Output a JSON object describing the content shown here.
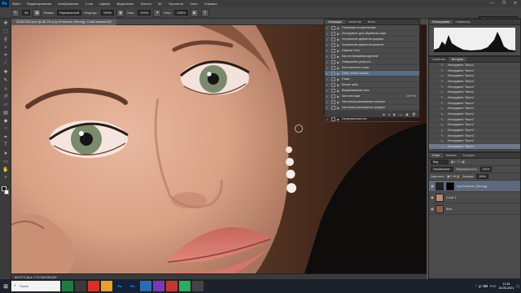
{
  "menubar": {
    "logo": "Ps",
    "items": [
      "Файл",
      "Редактирование",
      "Изображение",
      "Слои",
      "Шрифт",
      "Выделение",
      "Фильтр",
      "3D",
      "Просмотр",
      "Окно",
      "Справка"
    ],
    "window_controls": [
      "—",
      "❐",
      "✕"
    ]
  },
  "options": {
    "size": "45",
    "mode_label": "Режим:",
    "mode_value": "Нормальный",
    "opacity_label": "Непрозр.:",
    "opacity_value": "100%",
    "flow_label": "Наж.:",
    "flow_value": "100%",
    "flow2_label": "Наж.:",
    "flow2_value": "100%",
    "workspace": "Фотография"
  },
  "document": {
    "tab_title": "22367330.psd @ 66,7% (Lip Enhancer (Strong), Слой-маска/16)*",
    "status": "66,67%        Док: 172,9М/348,8М",
    "mini_tab": "Mini Bridge"
  },
  "actions": {
    "tabs": [
      "Операции",
      "Свойства",
      "Кисть"
    ],
    "active_tab": "Операции",
    "rows": [
      {
        "label": "Операции по умолчанию",
        "key": "",
        "selected": false,
        "checked": true
      },
      {
        "label": "Инструмент для обработки кожи",
        "key": "",
        "selected": false,
        "checked": true
      },
      {
        "label": "Устранение дефектов средних",
        "key": "",
        "selected": false,
        "checked": true
      },
      {
        "label": "Устранение дефектов сильное",
        "key": "",
        "selected": false,
        "checked": true
      },
      {
        "label": "Нижние тона",
        "key": "",
        "selected": false,
        "checked": true
      },
      {
        "label": "Как на глянцевом журнале",
        "key": "",
        "selected": false,
        "checked": true
      },
      {
        "label": "Повышение резкости",
        "key": "",
        "selected": false,
        "checked": true
      },
      {
        "label": "Контрастность кожи",
        "key": "",
        "selected": false,
        "checked": true
      },
      {
        "label": "Губы, очень сильно",
        "key": "",
        "selected": true,
        "checked": true
      },
      {
        "label": "Глаза",
        "key": "",
        "selected": false,
        "checked": true
      },
      {
        "label": "Белые зубы",
        "key": "",
        "selected": false,
        "checked": true
      },
      {
        "label": "Выравнивание тона",
        "key": "",
        "selected": false,
        "checked": true
      },
      {
        "label": "Чистота кожи",
        "key": "Ctrl+F4",
        "selected": false,
        "checked": true
      },
      {
        "label": "Частотное разложение сильное",
        "key": "",
        "selected": false,
        "checked": true
      },
      {
        "label": "Частотное разложение среднее",
        "key": "",
        "selected": false,
        "checked": true
      },
      {
        "label": "Частотное разложение",
        "key": "",
        "selected": false,
        "checked": true
      },
      {
        "label": "Остановочная поч",
        "key": "",
        "selected": false,
        "checked": true
      }
    ]
  },
  "histogram": {
    "tabs": [
      "Гистограмма",
      "Навигатор"
    ],
    "active_tab": "Гистограмма"
  },
  "history": {
    "tabs": [
      "Свойства",
      "История"
    ],
    "active_tab": "История",
    "rows": [
      {
        "label": "Инструмент \"Кисть\"",
        "selected": false
      },
      {
        "label": "Инструмент \"Кисть\"",
        "selected": false
      },
      {
        "label": "Инструмент \"Кисть\"",
        "selected": false
      },
      {
        "label": "Инструмент \"Кисть\"",
        "selected": false
      },
      {
        "label": "Инструмент \"Кисть\"",
        "selected": false
      },
      {
        "label": "Инструмент \"Кисть\"",
        "selected": false
      },
      {
        "label": "Инструмент \"Кисть\"",
        "selected": false
      },
      {
        "label": "Инструмент \"Кисть\"",
        "selected": false
      },
      {
        "label": "Инструмент \"Кисть\"",
        "selected": false
      },
      {
        "label": "Инструмент \"Кисть\"",
        "selected": false
      },
      {
        "label": "Инструмент \"Кисть\"",
        "selected": false
      },
      {
        "label": "Инструмент \"Кисть\"",
        "selected": false
      },
      {
        "label": "Инструмент \"Кисть\"",
        "selected": false
      },
      {
        "label": "Инструмент \"Кисть\"",
        "selected": false
      },
      {
        "label": "Инструмент \"Кисть\"",
        "selected": false
      },
      {
        "label": "Инструмент \"Кисть\"",
        "selected": true
      }
    ]
  },
  "layers": {
    "tabs": [
      "Слои",
      "Каналы",
      "Контуры"
    ],
    "active_tab": "Слои",
    "kind": "Вид",
    "blend": "Нормальные",
    "opacity_label": "Непрозрачность:",
    "opacity": "100%",
    "lock_label": "Закрепить:",
    "fill_label": "Заливка:",
    "fill": "100%",
    "rows": [
      {
        "label": "Lip Enhancer (Strong)",
        "selected": true,
        "thumb": "#222222"
      },
      {
        "label": "Слой 1",
        "selected": false,
        "thumb": "#b98a70"
      },
      {
        "label": "Фон",
        "selected": false,
        "thumb": "#8a5f4a"
      }
    ]
  },
  "taskbar": {
    "search_placeholder": "Поиск",
    "apps": [
      "",
      "",
      "",
      "",
      "Ps",
      "Ps",
      "",
      "",
      "",
      "",
      ""
    ],
    "tray_lang": "РУС",
    "time": "11:34",
    "date": "15.06.2021"
  },
  "colors": {
    "accent_selected": "#5a6d87",
    "ps_blue": "#31a8ff",
    "panel_bg": "#4b4b4b"
  }
}
